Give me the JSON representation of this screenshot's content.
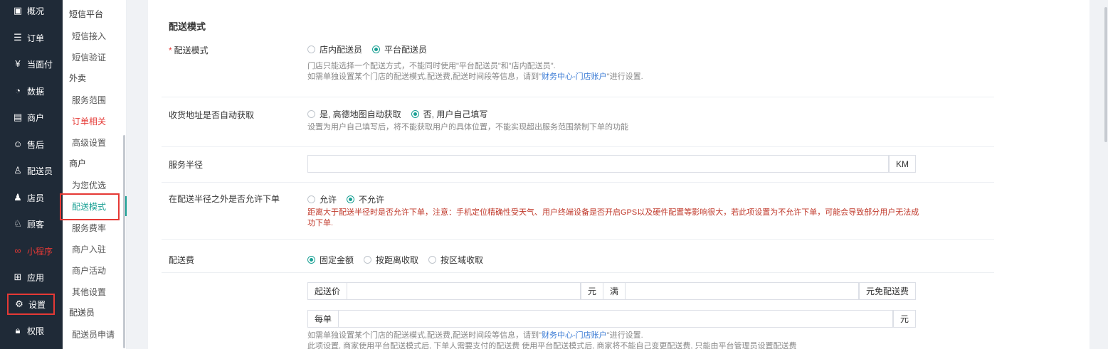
{
  "sidebar": {
    "items": [
      {
        "label": "概况",
        "icon": "grid-icon"
      },
      {
        "label": "订单",
        "icon": "list-icon"
      },
      {
        "label": "当面付",
        "icon": "yen-icon"
      },
      {
        "label": "数据",
        "icon": "chart-icon"
      },
      {
        "label": "商户",
        "icon": "store-icon"
      },
      {
        "label": "售后",
        "icon": "service-icon"
      },
      {
        "label": "配送员",
        "icon": "user-icon"
      },
      {
        "label": "店员",
        "icon": "staff-icon"
      },
      {
        "label": "顾客",
        "icon": "customer-icon"
      },
      {
        "label": "小程序",
        "icon": "miniapp-icon"
      },
      {
        "label": "应用",
        "icon": "apps-icon"
      },
      {
        "label": "设置",
        "icon": "gear-icon"
      },
      {
        "label": "权限",
        "icon": "lock-icon"
      }
    ]
  },
  "subnav": {
    "groups": [
      {
        "title": "短信平台",
        "items": [
          "短信接入",
          "短信验证"
        ]
      },
      {
        "title": "外卖",
        "items": [
          "服务范围",
          "订单相关",
          "高级设置"
        ]
      },
      {
        "title": "商户",
        "items": [
          "为您优选",
          "配送模式",
          "服务费率",
          "商户入驻",
          "商户活动",
          "其他设置"
        ]
      },
      {
        "title": "配送员",
        "items": [
          "配送员申请"
        ]
      }
    ]
  },
  "main": {
    "section_title": "配送模式",
    "mode": {
      "label": "配送模式",
      "required_mark": "*",
      "options": [
        "店内配送员",
        "平台配送员"
      ],
      "help_line1": "门店只能选择一个配送方式，不能同时使用\"平台配送员\"和\"店内配送员\".",
      "help_line2_prefix": "如需单独设置某个门店的配送模式,配送费,配送时间段等信息，请到\"",
      "help_link": "财务中心-门店账户",
      "help_line2_suffix": "\"进行设置."
    },
    "address": {
      "label": "收货地址是否自动获取",
      "options": [
        "是, 高德地图自动获取",
        "否, 用户自己填写"
      ],
      "help": "设置为用户自己填写后，将不能获取用户的具体位置，不能实现超出服务范围禁制下单的功能"
    },
    "radius": {
      "label": "服务半径",
      "value": "",
      "unit": "KM"
    },
    "outside": {
      "label": "在配送半径之外是否允许下单",
      "options": [
        "允许",
        "不允许"
      ],
      "warning": "距离大于配送半径时是否允许下单，注意：手机定位精确性受天气、用户终端设备是否开启GPS以及硬件配置等影响很大，若此项设置为不允许下单，可能会导致部分用户无法成功下单."
    },
    "fee": {
      "label": "配送费",
      "options": [
        "固定金额",
        "按距离收取",
        "按区域收取"
      ],
      "start_price_label": "起送价",
      "start_price_value": "",
      "yuan": "元",
      "man": "满",
      "free_value": "",
      "free_suffix": "元免配送费",
      "per_order_label": "每单",
      "per_order_value": "",
      "help_line1_prefix": "如需单独设置某个门店的配送模式,配送费,配送时间段等信息，请到\"",
      "help_link": "财务中心-门店账户",
      "help_line1_suffix": "\"进行设置.",
      "help_line2": "此项设置, 商家使用平台配送模式后, 下单人需要支付的配送费 使用平台配送模式后, 商家将不能自己变更配送费, 只能由平台管理员设置配送费"
    }
  },
  "colors": {
    "sidebar_bg": "#1f2a37",
    "accent": "#1aa094",
    "highlight": "#e53935",
    "link": "#3a7bd5"
  }
}
